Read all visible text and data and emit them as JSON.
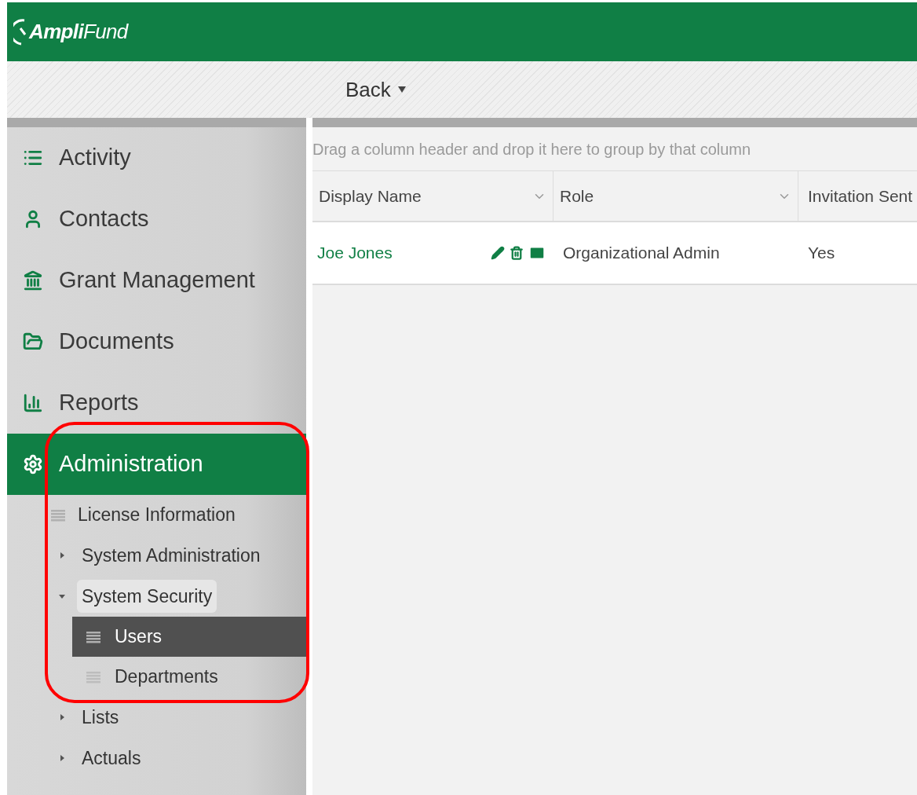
{
  "header": {
    "logo": "**Ampli**Fund"
  },
  "toolbar": {
    "back_button": "Back"
  },
  "sidebar": {
    "items": [
      {
        "label": "Activity",
        "selected": false
      },
      {
        "label": "Contacts",
        "selected": false
      },
      {
        "label": "Grant Management",
        "selected": false
      },
      {
        "label": "Documents",
        "selected": false
      },
      {
        "label": "Reports",
        "selected": false
      },
      {
        "label": "Administration",
        "selected": true,
        "children": [
          {
            "label": "License Information",
            "kind": "page",
            "selected": false
          },
          {
            "label": "System Administration",
            "kind": "folder",
            "expanded": false
          },
          {
            "label": "System Security",
            "kind": "folder",
            "expanded": true,
            "children": [
              {
                "label": "Users",
                "kind": "page",
                "selected": true
              },
              {
                "label": "Departments",
                "kind": "page",
                "selected": false
              }
            ]
          },
          {
            "label": "Lists",
            "kind": "folder",
            "expanded": false
          },
          {
            "label": "Actuals",
            "kind": "folder",
            "expanded": false
          }
        ]
      }
    ]
  },
  "grid": {
    "group_hint": "Drag a column header and drop it here to group by that column",
    "columns": [
      {
        "label": "Display Name",
        "menu": true
      },
      {
        "label": "Role",
        "menu": true
      },
      {
        "label": "Invitation Sent",
        "menu": false
      }
    ],
    "rows": [
      {
        "display_name": "Joe Jones",
        "role": "Organizational Admin",
        "invitation_sent": "Yes"
      }
    ]
  },
  "annotation": {
    "kind": "outline",
    "color": "#ff0000"
  }
}
